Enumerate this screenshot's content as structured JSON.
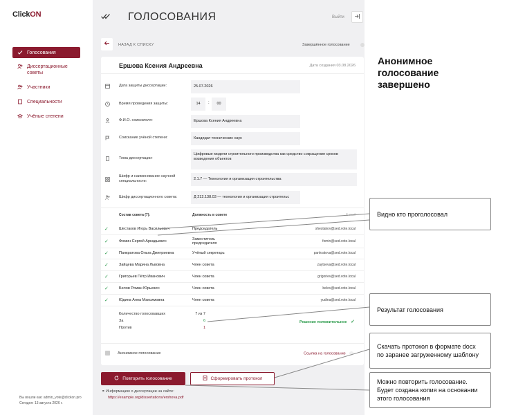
{
  "logo": {
    "part1": "Click",
    "part2": "ON"
  },
  "sidebar": {
    "items": [
      {
        "label": "Голосования"
      },
      {
        "label": "Диссертационные советы"
      },
      {
        "label": "Участники"
      },
      {
        "label": "Специальности"
      },
      {
        "label": "Учёные степени"
      }
    ],
    "user_line1": "Вы вошли как: admin_vote@clickon.pro",
    "user_line2": "Сегодня: 13 августа 2026 г."
  },
  "header": {
    "title": "ГОЛОСОВАНИЯ",
    "exit_label": "Выйти"
  },
  "nav": {
    "back_label": "НАЗАД К СПИСКУ",
    "status_label": "Завершённое голосование"
  },
  "card": {
    "name": "Ершова Ксения Андреевна",
    "date": "Дата создания 03.08.2026",
    "fields": {
      "defense_date_label": "Дата защиты диссертации:",
      "defense_date_value": "25.07.2026",
      "defense_time_label": "Время проведения защиты:",
      "defense_hour": "14",
      "defense_minute": "00",
      "candidate_label": "Ф.И.О. соискателя:",
      "candidate_value": "Ершова Ксения Андреевна",
      "degree_label": "Соискание учёной степени:",
      "degree_value": "Кандидат технических наук",
      "topic_label": "Тема диссертации:",
      "topic_value": "Цифровые модели строительного производства как средство сокращения сроков возведения объектов",
      "specialty_label": "Шифр и наименование научной специальности:",
      "specialty_value": "2.1.7 — Технология и организация строительства",
      "council_label": "Шифр диссертационного совета:",
      "council_value": "Д 212.138.03 — технология и организация строительс"
    },
    "members_header": {
      "col1": "Состав совета (7):",
      "col2": "Должность в совете",
      "col3": "E-mail"
    },
    "members": [
      {
        "name": "Шестаков Игорь Васильевич",
        "position": "Председатель",
        "email": "shestakov@sed.vote.local"
      },
      {
        "name": "Фомин Сергей Аркадьевич",
        "position": "Заместитель председателя",
        "email": "fomin@sed.vote.local"
      },
      {
        "name": "Панкратова Ольга Дмитриевна",
        "position": "Учёный секретарь",
        "email": "pankratova@sed.vote.local"
      },
      {
        "name": "Зайцева Марина Львовна",
        "position": "Член совета",
        "email": "zaytseva@sed.vote.local"
      },
      {
        "name": "Григорьев Пётр Иванович",
        "position": "Член совета",
        "email": "grigoriev@sed.vote.local"
      },
      {
        "name": "Белов Роман Юрьевич",
        "position": "Член совета",
        "email": "belov@sed.vote.local"
      },
      {
        "name": "Юдина Анна Максимовна",
        "position": "Член совета",
        "email": "yudina@sed.vote.local"
      }
    ],
    "results": {
      "count_label": "Количество голосовавших",
      "count_value": "7 из 7",
      "for_label": "За",
      "for_value": "6",
      "against_label": "Против",
      "against_value": "1"
    },
    "decision": "Решение положительное",
    "anon_label": "Анонимное голосование",
    "link_label": "Ссылка на голосование"
  },
  "actions": {
    "repeat_label": "Повторить голосование",
    "protocol_label": "Сформировать протокол",
    "info_label": "Информацию о диссертации на сайте:",
    "info_link": "https://example.org/dissertations/ershova.pdf"
  },
  "annotations": {
    "heading": "Анонимное голосование завершено",
    "voted": "Видно кто проголосовал",
    "result": "Результат голосования",
    "download": "Скачать протокол в формате docx по заранее загруженному шаблону",
    "repeat": "Можно повторить голосование. Будет создана копия на основании этого голосования"
  },
  "colors": {
    "accent": "#8b1a2e",
    "success": "#2a9a4a"
  }
}
